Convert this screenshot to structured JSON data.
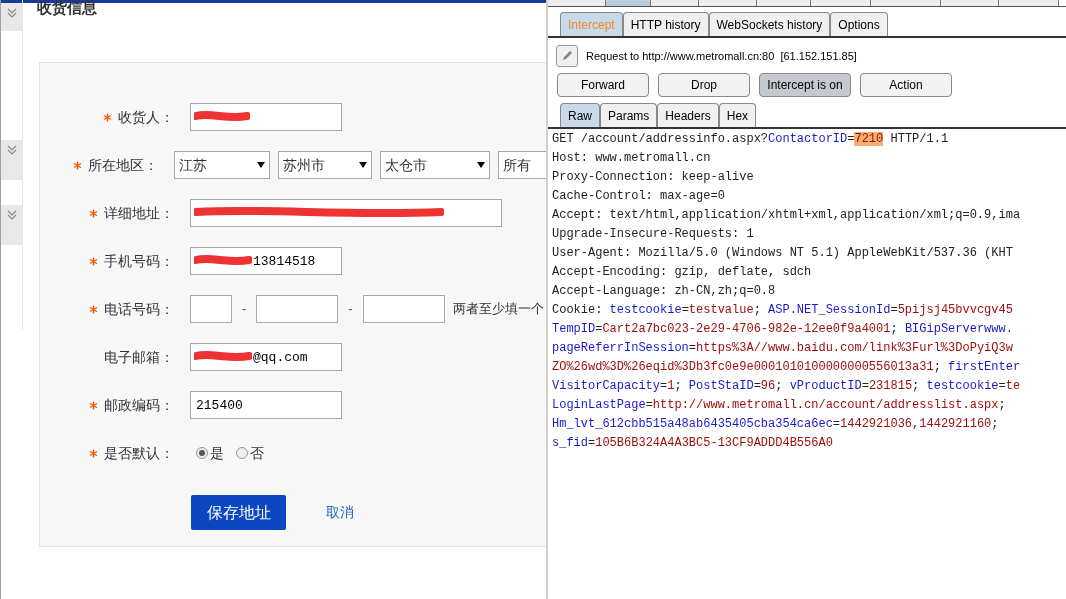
{
  "left_page": {
    "section_title": "收货信息",
    "fields": [
      {
        "kind": "text",
        "label": "收货人：",
        "required": true,
        "redacted": true
      },
      {
        "kind": "selects",
        "label": "所在地区：",
        "required": true,
        "options": [
          "江苏",
          "苏州市",
          "太仓市",
          "所有"
        ]
      },
      {
        "kind": "wide",
        "label": "详细地址：",
        "required": true,
        "redacted": true
      },
      {
        "kind": "text",
        "label": "手机号码：",
        "required": true,
        "value": "13814518",
        "redacted": true
      },
      {
        "kind": "phone",
        "label": "电话号码：",
        "required": true,
        "separators": [
          "-",
          "-"
        ],
        "hint": "两者至少填一个"
      },
      {
        "kind": "text",
        "label": "电子邮箱：",
        "required": false,
        "value": "@qq.com",
        "redacted": true
      },
      {
        "kind": "text",
        "label": "邮政编码：",
        "required": true,
        "value": "215400"
      },
      {
        "kind": "radio",
        "label": "是否默认：",
        "required": true,
        "choices": [
          {
            "label": "是",
            "selected": true
          },
          {
            "label": "否",
            "selected": false
          }
        ]
      }
    ],
    "save_button": "保存地址",
    "cancel_link": "取消"
  },
  "proxy": {
    "tabs": [
      {
        "label": "Intercept",
        "selected": true
      },
      {
        "label": "HTTP history",
        "selected": false
      },
      {
        "label": "WebSockets history",
        "selected": false
      },
      {
        "label": "Options",
        "selected": false
      }
    ],
    "request_info": "Request to http://www.metromall.cn:80  [61.152.151.85]",
    "buttons": [
      {
        "label": "Forward",
        "pressed": false
      },
      {
        "label": "Drop",
        "pressed": false
      },
      {
        "label": "Intercept is on",
        "pressed": true
      },
      {
        "label": "Action",
        "pressed": false
      }
    ],
    "view_tabs": [
      {
        "label": "Raw",
        "selected": true
      },
      {
        "label": "Params",
        "selected": false
      },
      {
        "label": "Headers",
        "selected": false
      },
      {
        "label": "Hex",
        "selected": false
      }
    ],
    "request_lines": [
      [
        {
          "kind": "plain",
          "text": "GET /account/addressinfo.aspx?"
        },
        {
          "kind": "key",
          "text": "ContactorID"
        },
        {
          "kind": "plain",
          "text": "="
        },
        {
          "kind": "highlight",
          "text": "7210"
        },
        {
          "kind": "plain",
          "text": " HTTP/1.1"
        }
      ],
      [
        {
          "kind": "plain",
          "text": "Host: www.metromall.cn"
        }
      ],
      [
        {
          "kind": "plain",
          "text": "Proxy-Connection: keep-alive"
        }
      ],
      [
        {
          "kind": "plain",
          "text": "Cache-Control: max-age=0"
        }
      ],
      [
        {
          "kind": "plain",
          "text": "Accept: text/html,application/xhtml+xml,application/xml;q=0.9,ima"
        }
      ],
      [
        {
          "kind": "plain",
          "text": "Upgrade-Insecure-Requests: 1"
        }
      ],
      [
        {
          "kind": "plain",
          "text": "User-Agent: Mozilla/5.0 (Windows NT 5.1) AppleWebKit/537.36 (KHT"
        }
      ],
      [
        {
          "kind": "plain",
          "text": "Accept-Encoding: gzip, deflate, sdch"
        }
      ],
      [
        {
          "kind": "plain",
          "text": "Accept-Language: zh-CN,zh;q=0.8"
        }
      ],
      [
        {
          "kind": "plain",
          "text": "Cookie: "
        },
        {
          "kind": "key",
          "text": "testcookie"
        },
        {
          "kind": "plain",
          "text": "="
        },
        {
          "kind": "value",
          "text": "testvalue"
        },
        {
          "kind": "plain",
          "text": "; "
        },
        {
          "kind": "key",
          "text": "ASP.NET_SessionId"
        },
        {
          "kind": "plain",
          "text": "="
        },
        {
          "kind": "value",
          "text": "5pijsj45bvvcgv45"
        }
      ],
      [
        {
          "kind": "key",
          "text": "TempID"
        },
        {
          "kind": "plain",
          "text": "="
        },
        {
          "kind": "value",
          "text": "Cart2a7bc023-2e29-4706-982e-12ee0f9a4001"
        },
        {
          "kind": "plain",
          "text": "; "
        },
        {
          "kind": "key",
          "text": "BIGipServerwww."
        }
      ],
      [
        {
          "kind": "key",
          "text": "pageReferrInSession"
        },
        {
          "kind": "plain",
          "text": "="
        },
        {
          "kind": "value",
          "text": "https%3A//www.baidu.com/link%3Furl%3DoPyiQ3w"
        }
      ],
      [
        {
          "kind": "value",
          "text": "ZO%26wd%3D%26eqid%3Db3fc0e9e0001010100000000556013a31"
        },
        {
          "kind": "plain",
          "text": "; "
        },
        {
          "kind": "key",
          "text": "firstEnter"
        }
      ],
      [
        {
          "kind": "key",
          "text": "VisitorCapacity"
        },
        {
          "kind": "plain",
          "text": "="
        },
        {
          "kind": "value",
          "text": "1"
        },
        {
          "kind": "plain",
          "text": "; "
        },
        {
          "kind": "key",
          "text": "PostStaID"
        },
        {
          "kind": "plain",
          "text": "="
        },
        {
          "kind": "value",
          "text": "96"
        },
        {
          "kind": "plain",
          "text": "; "
        },
        {
          "kind": "key",
          "text": "vProductID"
        },
        {
          "kind": "plain",
          "text": "="
        },
        {
          "kind": "value",
          "text": "231815"
        },
        {
          "kind": "plain",
          "text": "; "
        },
        {
          "kind": "key",
          "text": "testcookie"
        },
        {
          "kind": "plain",
          "text": "="
        },
        {
          "kind": "value",
          "text": "te"
        }
      ],
      [
        {
          "kind": "key",
          "text": "LoginLastPage"
        },
        {
          "kind": "plain",
          "text": "="
        },
        {
          "kind": "value",
          "text": "http://www.metromall.cn/account/addresslist.aspx"
        },
        {
          "kind": "plain",
          "text": ";"
        }
      ],
      [
        {
          "kind": "key",
          "text": "Hm_lvt_612cbb515a48ab6435405cba354ca6ec"
        },
        {
          "kind": "plain",
          "text": "="
        },
        {
          "kind": "value",
          "text": "1442921036,1442921160"
        },
        {
          "kind": "plain",
          "text": ";"
        }
      ],
      [
        {
          "kind": "key",
          "text": "s_fid"
        },
        {
          "kind": "plain",
          "text": "="
        },
        {
          "kind": "value",
          "text": "105B6B324A4A3BC5-13CF9ADDD4B556A0"
        }
      ]
    ]
  }
}
